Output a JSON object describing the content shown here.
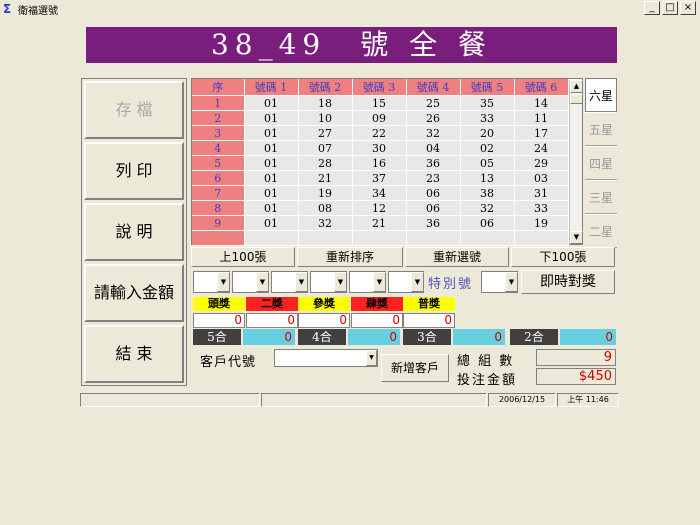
{
  "window": {
    "title": "衛福選號"
  },
  "banner": {
    "title": "38_49　號 全 餐"
  },
  "left_buttons": [
    {
      "label": "存 檔"
    },
    {
      "label": "列 印"
    },
    {
      "label": "說 明"
    },
    {
      "label": "請輸入金額"
    },
    {
      "label": "結 束"
    }
  ],
  "grid": {
    "headers": [
      "序",
      "號碼 1",
      "號碼 2",
      "號碼 3",
      "號碼 4",
      "號碼 5",
      "號碼 6"
    ],
    "rows": [
      [
        "1",
        "01",
        "18",
        "15",
        "25",
        "35",
        "14"
      ],
      [
        "2",
        "01",
        "10",
        "09",
        "26",
        "33",
        "11"
      ],
      [
        "3",
        "01",
        "27",
        "22",
        "32",
        "20",
        "17"
      ],
      [
        "4",
        "01",
        "07",
        "30",
        "04",
        "02",
        "24"
      ],
      [
        "5",
        "01",
        "28",
        "16",
        "36",
        "05",
        "29"
      ],
      [
        "6",
        "01",
        "21",
        "37",
        "23",
        "13",
        "03"
      ],
      [
        "7",
        "01",
        "19",
        "34",
        "06",
        "38",
        "31"
      ],
      [
        "8",
        "01",
        "08",
        "12",
        "06",
        "32",
        "33"
      ],
      [
        "9",
        "01",
        "32",
        "21",
        "36",
        "06",
        "19"
      ]
    ]
  },
  "star_tabs": [
    "六星",
    "五星",
    "四星",
    "三星",
    "二星"
  ],
  "actions": {
    "prev": "上100張",
    "resort": "重新排序",
    "reselect": "重新選號",
    "next": "下100張"
  },
  "special_label": "特別號",
  "check_button": "即時對獎",
  "prizes": [
    {
      "label": "頭獎",
      "value": "0",
      "color": "#ffff00"
    },
    {
      "label": "二獎",
      "value": "0",
      "color": "#ff2020"
    },
    {
      "label": "參獎",
      "value": "0",
      "color": "#ffff00"
    },
    {
      "label": "肆獎",
      "value": "0",
      "color": "#ff2020"
    },
    {
      "label": "普獎",
      "value": "0",
      "color": "#ffff00"
    }
  ],
  "hits": [
    {
      "label": "5合",
      "value": "0"
    },
    {
      "label": "4合",
      "value": "0"
    },
    {
      "label": "3合",
      "value": "0"
    },
    {
      "label": "2合",
      "value": "0"
    }
  ],
  "customer": {
    "label": "客戶代號",
    "new_button": "新增客戶"
  },
  "summary": {
    "groups_label": "總 組 數",
    "groups_value": "9",
    "amount_label": "投注金額",
    "amount_value": "$450"
  },
  "status": {
    "date": "2006/12/15",
    "time": "上午 11:46"
  }
}
